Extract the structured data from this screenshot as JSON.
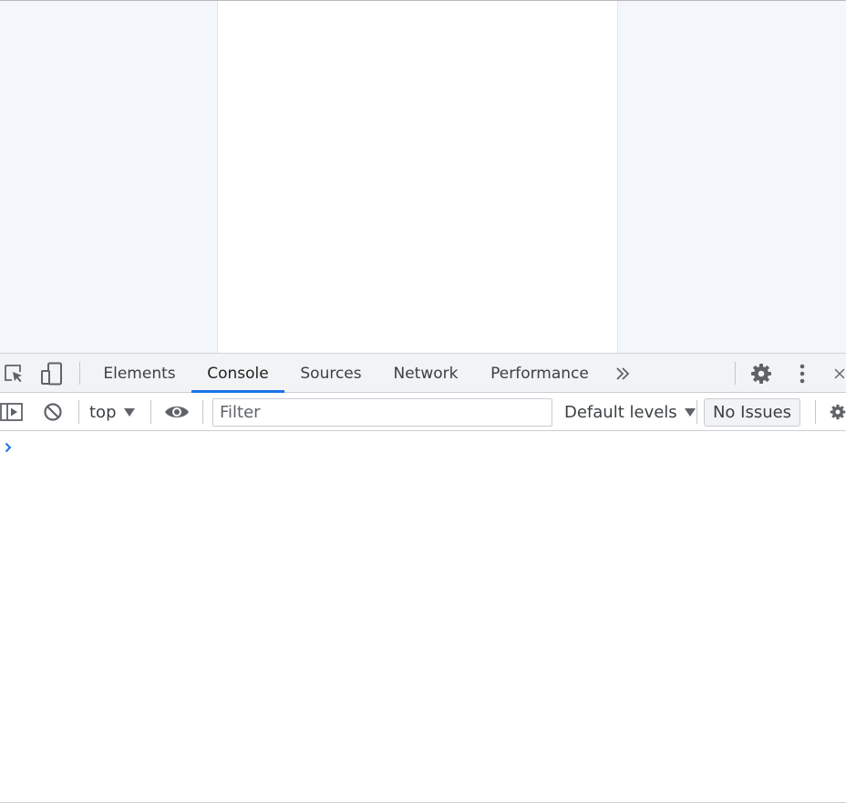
{
  "devtools": {
    "tabs": [
      {
        "label": "Elements",
        "active": false
      },
      {
        "label": "Console",
        "active": true
      },
      {
        "label": "Sources",
        "active": false
      },
      {
        "label": "Network",
        "active": false
      },
      {
        "label": "Performance",
        "active": false
      }
    ],
    "toolbar_icons": [
      "inspect-element-icon",
      "device-toolbar-icon",
      "more-tabs-icon",
      "settings-icon",
      "more-options-icon",
      "close-icon"
    ]
  },
  "console_toolbar": {
    "context": "top",
    "filter_placeholder": "Filter",
    "filter_value": "",
    "levels_label": "Default levels",
    "issues_label": "No Issues",
    "icons": [
      "sidebar-toggle-icon",
      "clear-console-icon",
      "eye-icon",
      "console-settings-icon"
    ]
  },
  "console": {
    "prompt_icon": "chevron-right-icon",
    "input_value": ""
  },
  "colors": {
    "accent": "#1a73e8",
    "viewport_bg": "#f3f6fa",
    "tabbar_bg": "#f1f3f4",
    "icon": "#5f6368"
  }
}
